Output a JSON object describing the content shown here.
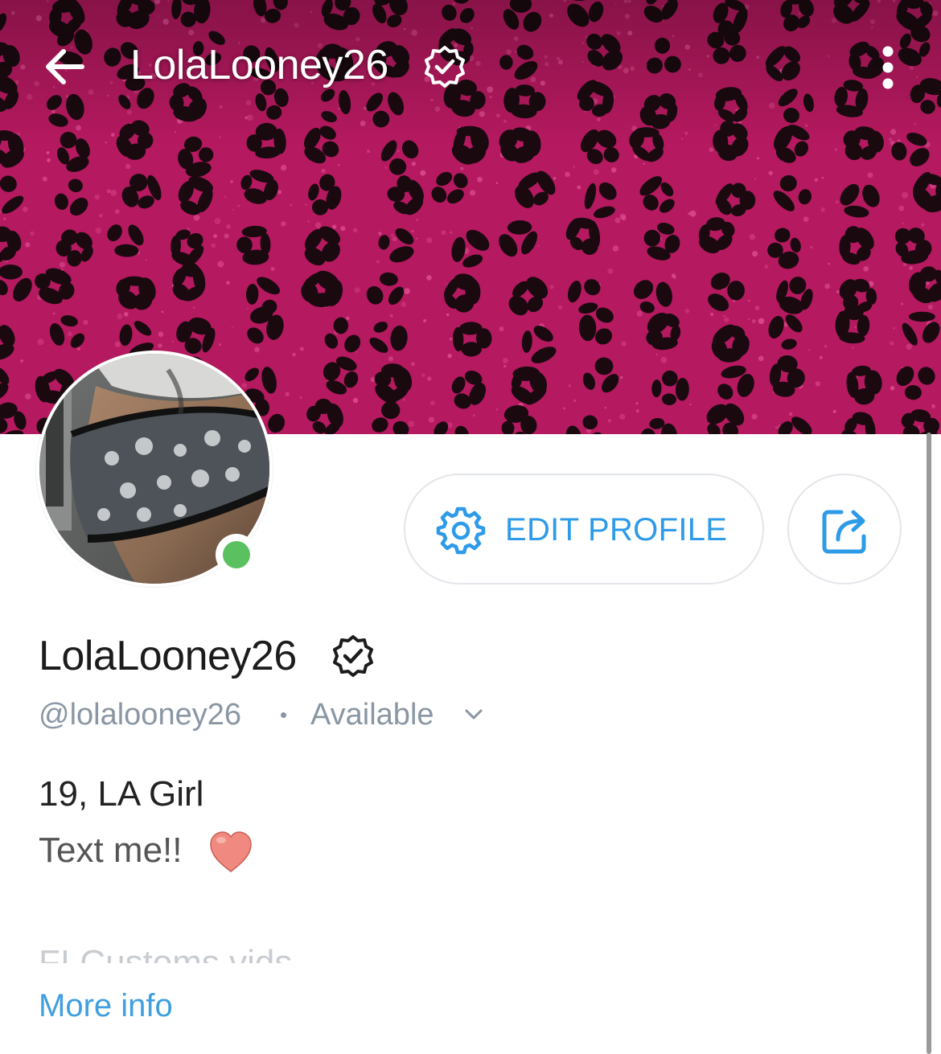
{
  "header": {
    "title": "LolaLooney26",
    "back_icon": "arrow-left-icon",
    "menu_icon": "more-vertical-icon",
    "verified_icon": "verified-badge-icon"
  },
  "cover": {
    "pattern": "pink-leopard-print",
    "colors": {
      "base": "#b5195f",
      "spot": "#1a0a10",
      "highlight": "#e75a9c"
    }
  },
  "profile": {
    "avatar_status": "online",
    "display_name": "LolaLooney26",
    "handle": "@lolalooney26",
    "separator": "•",
    "status": "Available",
    "status_icon": "chevron-down-icon"
  },
  "actions": {
    "edit_profile_label": "EDIT PROFILE",
    "edit_icon": "gear-icon",
    "share_icon": "share-icon",
    "accent": "#2e9be8"
  },
  "bio": {
    "line1": "19, LA Girl",
    "line2": "Text me!!",
    "line2_emoji": "heart-icon",
    "truncated_line": "FI Customs vids",
    "more_info_label": "More info"
  }
}
